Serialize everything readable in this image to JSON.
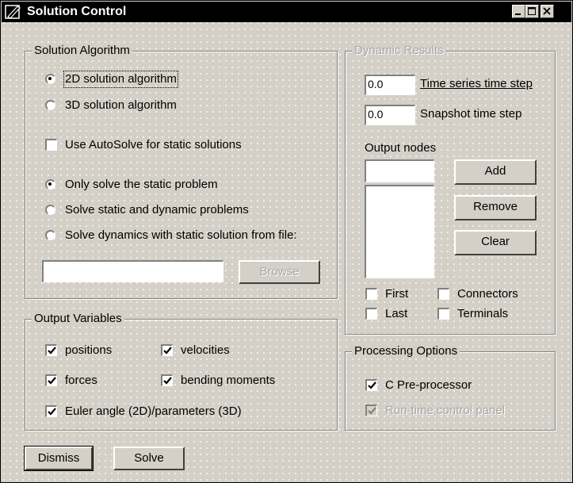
{
  "window": {
    "title": "Solution Control",
    "icons": {
      "app": "pencil-icon",
      "minimize": "minimize-icon",
      "maximize": "maximize-icon",
      "close": "close-icon"
    }
  },
  "solution_algorithm": {
    "legend": "Solution Algorithm",
    "algorithms": [
      {
        "label": "2D solution algorithm",
        "checked": true
      },
      {
        "label": "3D solution algorithm",
        "checked": false
      }
    ],
    "autosolve": {
      "label": "Use AutoSolve for static solutions",
      "checked": false
    },
    "modes": [
      {
        "label": "Only solve the static problem",
        "checked": true
      },
      {
        "label": "Solve static and dynamic problems",
        "checked": false
      },
      {
        "label": "Solve dynamics with static solution from file:",
        "checked": false
      }
    ],
    "file_value": "",
    "browse_label": "Browse"
  },
  "dynamic_results": {
    "legend": "Dynamic Results",
    "time_series_step": {
      "value": "0.0",
      "label": "Time series time step"
    },
    "snapshot_step": {
      "value": "0.0",
      "label": "Snapshot time step"
    },
    "output_nodes_label": "Output nodes",
    "node_input_value": "",
    "add_label": "Add",
    "remove_label": "Remove",
    "clear_label": "Clear",
    "checks": [
      {
        "label": "First",
        "checked": false
      },
      {
        "label": "Connectors",
        "checked": false
      },
      {
        "label": "Last",
        "checked": false
      },
      {
        "label": "Terminals",
        "checked": false
      }
    ]
  },
  "output_variables": {
    "legend": "Output Variables",
    "items": [
      {
        "label": "positions",
        "checked": true
      },
      {
        "label": "velocities",
        "checked": true
      },
      {
        "label": "forces",
        "checked": true
      },
      {
        "label": "bending moments",
        "checked": true
      },
      {
        "label": "Euler angle (2D)/parameters (3D)",
        "checked": true
      }
    ]
  },
  "processing_options": {
    "legend": "Processing Options",
    "c_preprocessor": {
      "label": "C Pre-processor",
      "checked": true
    },
    "runtime_panel": {
      "label": "Run-time control panel",
      "checked": true
    }
  },
  "footer": {
    "dismiss_label": "Dismiss",
    "solve_label": "Solve"
  }
}
